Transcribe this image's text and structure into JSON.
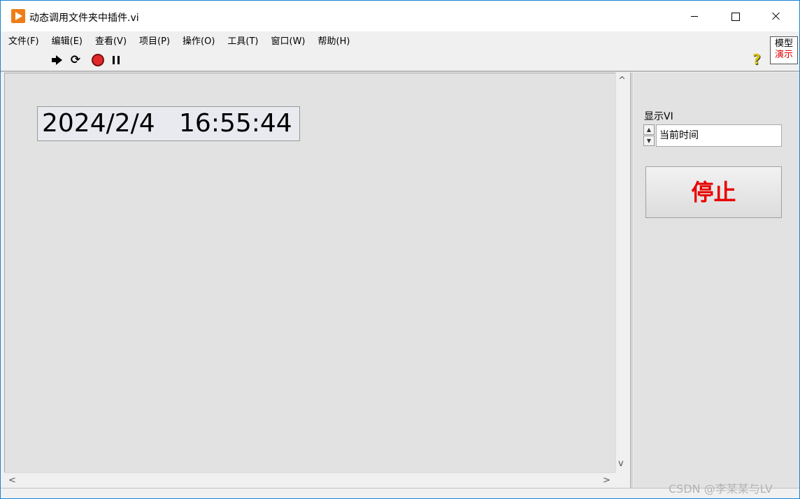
{
  "window": {
    "title": "动态调用文件夹中插件.vi"
  },
  "menu": {
    "items": [
      {
        "label": "文件(F)"
      },
      {
        "label": "编辑(E)"
      },
      {
        "label": "查看(V)"
      },
      {
        "label": "项目(P)"
      },
      {
        "label": "操作(O)"
      },
      {
        "label": "工具(T)"
      },
      {
        "label": "窗口(W)"
      },
      {
        "label": "帮助(H)"
      }
    ]
  },
  "context_badge": {
    "line1": "模型",
    "line2": "演示",
    "line2_color": "#e00000"
  },
  "toolbar": {
    "icons": [
      "run-arrow-icon",
      "run-continuously-icon",
      "abort-icon",
      "pause-icon",
      "help-icon"
    ],
    "help_glyph": "?"
  },
  "front_panel": {
    "datetime": "2024/2/4   16:55:44"
  },
  "right_pane": {
    "ring_label": "显示VI",
    "ring_value": "当前时间",
    "stop_label": "停止",
    "stop_color": "#e80000"
  },
  "scrollbars": {
    "up": "^",
    "down": "v",
    "left": "<",
    "right": ">"
  },
  "watermark": "CSDN @李某某与LV"
}
